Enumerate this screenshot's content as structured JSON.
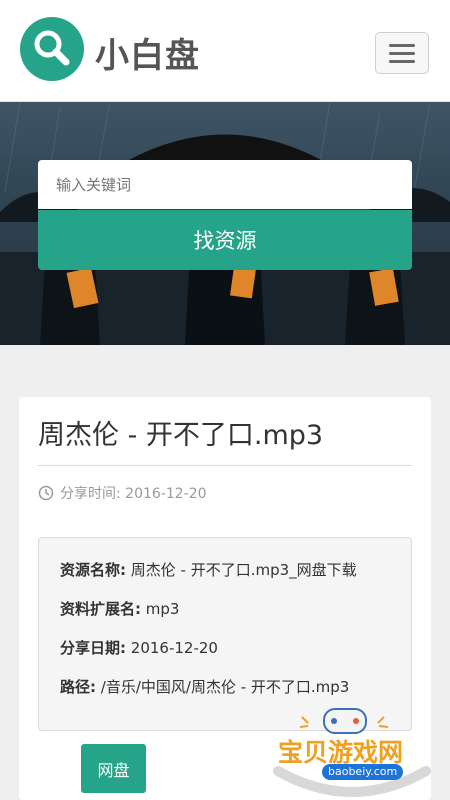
{
  "header": {
    "brand": "小白盘",
    "logo_icon": "search-icon",
    "menu_icon": "hamburger-menu-icon"
  },
  "hero": {
    "search_placeholder": "输入关键词",
    "search_button": "找资源"
  },
  "resource": {
    "title": "周杰伦 - 开不了口.mp3",
    "share_icon": "clock-icon",
    "share_time": "分享时间: 2016-12-20",
    "details": [
      {
        "label": "资源名称:",
        "value": "周杰伦 - 开不了口.mp3_网盘下载"
      },
      {
        "label": "资料扩展名:",
        "value": "mp3"
      },
      {
        "label": "分享日期:",
        "value": "2016-12-20"
      },
      {
        "label": "路径:",
        "value": "/音乐/中国风/周杰伦 - 开不了口.mp3"
      }
    ],
    "disk_button": "网盘"
  },
  "watermark": {
    "text": "宝贝游戏网",
    "url": "baobeiy.com"
  },
  "colors": {
    "accent": "#26a489",
    "watermark_orange": "#f0a020",
    "watermark_blue": "#1e73d8"
  }
}
